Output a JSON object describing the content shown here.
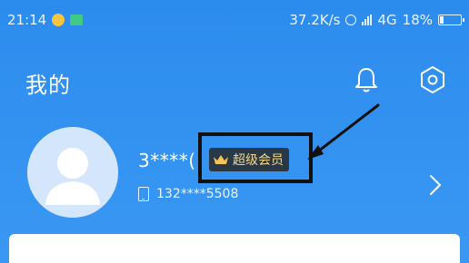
{
  "status_bar": {
    "time": "21:14",
    "speed": "37.2K/s",
    "network": "4G",
    "battery": "18%",
    "battery_level": 0.18
  },
  "header": {
    "title": "我的"
  },
  "profile": {
    "name": "3****(",
    "badge": "超级会员",
    "phone": "132****5508"
  },
  "colors": {
    "header_bg": "#2c8cee",
    "badge_bg": "#2a2a2a",
    "badge_text": "#f6d887"
  }
}
